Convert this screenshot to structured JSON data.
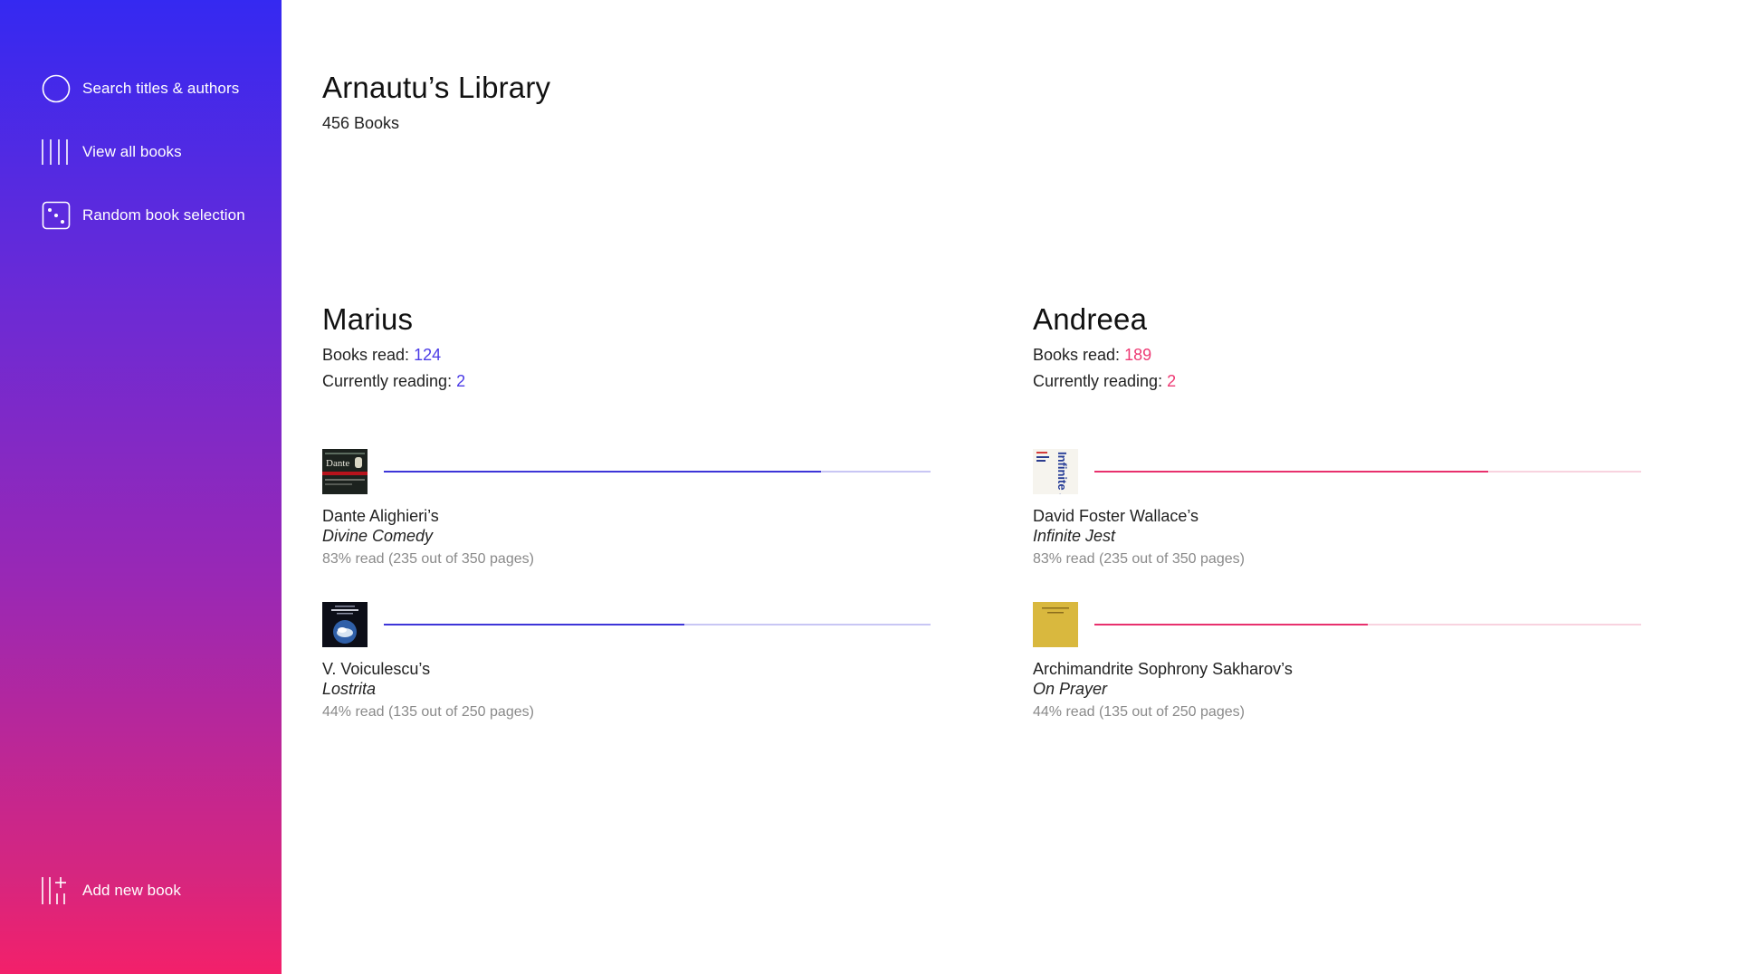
{
  "sidebar": {
    "items": [
      {
        "label": "Search titles & authors",
        "icon": "search-circle-icon"
      },
      {
        "label": "View all books",
        "icon": "books-bars-icon"
      },
      {
        "label": "Random book selection",
        "icon": "dice-icon"
      }
    ],
    "add": {
      "label": "Add new book",
      "icon": "add-book-icon"
    },
    "gradient": {
      "top": "#3529f1",
      "bottom": "#f3206a"
    }
  },
  "library": {
    "title": "Arnautu’s Library",
    "count": "456 Books"
  },
  "readers": [
    {
      "name": "Marius",
      "books_read_label": "Books read: ",
      "books_read": "124",
      "current_label": "Currently reading: ",
      "current": "2",
      "accent": "#4b3be6",
      "books": [
        {
          "author": "Dante Alighieri’s",
          "title": "Divine Comedy",
          "progress_text": "83% read (235 out of 350 pages)",
          "progress": 0.8
        },
        {
          "author": "V. Voiculescu’s",
          "title": "Lostrita",
          "progress_text": "44% read (135 out of 250 pages)",
          "progress": 0.55
        }
      ]
    },
    {
      "name": "Andreea",
      "books_read_label": "Books read: ",
      "books_read": "189",
      "current_label": "Currently reading: ",
      "current": "2",
      "accent": "#ee3a74",
      "books": [
        {
          "author": "David Foster Wallace’s",
          "title": "Infinite Jest",
          "progress_text": "83% read (235 out of 350 pages)",
          "progress": 0.72
        },
        {
          "author": "Archimandrite Sophrony Sakharov’s",
          "title": "On Prayer",
          "progress_text": "44% read (135 out of 250 pages)",
          "progress": 0.5
        }
      ]
    }
  ],
  "covers": {
    "divine_comedy": {
      "text": "Dante"
    },
    "infinite_jest": {
      "text": "Infinite Jest"
    }
  }
}
